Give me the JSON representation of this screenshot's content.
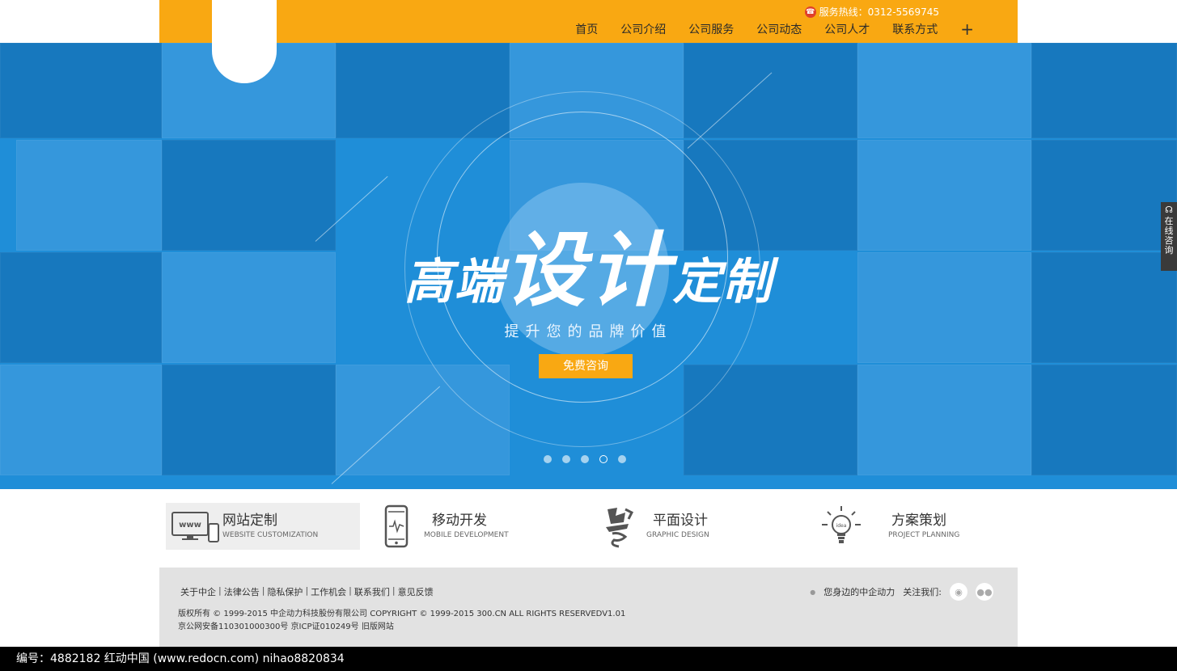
{
  "header": {
    "hotline_label": "服务热线：0312-5569745",
    "nav": [
      "首页",
      "公司介绍",
      "公司服务",
      "公司动态",
      "公司人才",
      "联系方式"
    ],
    "nav_plus": "+"
  },
  "hero": {
    "title_left": "高端",
    "title_big": "设计",
    "title_right": "定制",
    "subtitle": "提升您的品牌价值",
    "cta_label": "免费咨询",
    "slide_count": 5,
    "active_slide": 4
  },
  "side_consult": {
    "label": "在线咨询"
  },
  "services": [
    {
      "title": "网站定制",
      "en": "WEBSITE CUSTOMIZATION",
      "icon": "monitor-phone-icon",
      "active": true
    },
    {
      "title": "移动开发",
      "en": "MOBILE DEVELOPMENT",
      "icon": "smartphone-icon",
      "active": false
    },
    {
      "title": "平面设计",
      "en": "GRAPHIC DESIGN",
      "icon": "calligraphy-art-icon",
      "active": false
    },
    {
      "title": "方案策划",
      "en": "PROJECT PLANNING",
      "icon": "lightbulb-idea-icon",
      "active": false
    }
  ],
  "footer": {
    "links": [
      "关于中企",
      "法律公告",
      "隐私保护",
      "工作机会",
      "联系我们",
      "意见反馈"
    ],
    "copyright_line1": "版权所有 © 1999-2015 中企动力科技股份有限公司      COPYRIGHT © 1999-2015 300.CN ALL RIGHTS RESERVEDV1.01",
    "copyright_line2": "京公网安备110301000300号 京ICP证010249号 旧版网站",
    "tagline": "您身边的中企动力",
    "follow_label": "关注我们:"
  },
  "watermark_bar": "编号：4882182    红动中国 (www.redocn.com)    nihao8820834",
  "colors": {
    "accent": "#f9a812",
    "hero_blue": "#1f8ed8",
    "footer_gray": "#e2e2e2"
  }
}
